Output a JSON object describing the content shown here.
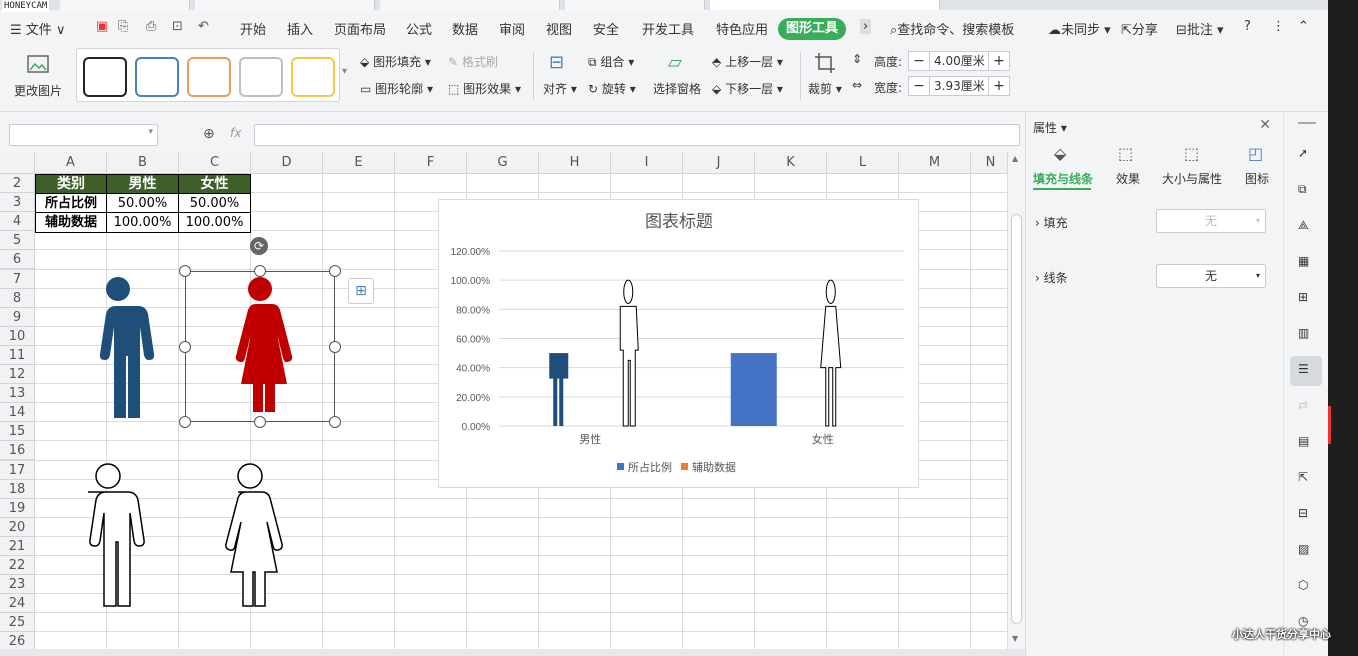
{
  "watermark_top": "HONEYCAM",
  "menu": {
    "file": "文件",
    "items": [
      "开始",
      "插入",
      "页面布局",
      "公式",
      "数据",
      "审阅",
      "视图",
      "安全",
      "开发工具",
      "特色应用"
    ],
    "active": "图形工具",
    "search": "查找命令、搜索模板",
    "sync": "未同步",
    "share": "分享",
    "annotate": "批注"
  },
  "ribbon": {
    "change_picture": "更改图片",
    "fill": "图形填充",
    "outline": "图形轮廓",
    "format_brush": "格式刷",
    "effect": "图形效果",
    "align": "对齐",
    "group": "组合",
    "rotate": "旋转",
    "selection_pane": "选择窗格",
    "bring_forward": "上移一层",
    "send_backward": "下移一层",
    "crop": "裁剪",
    "height_label": "高度:",
    "height_value": "4.00厘米",
    "width_label": "宽度:",
    "width_value": "3.93厘米",
    "swatch_colors": [
      "#222222",
      "#4a7fc1",
      "#e3a15a",
      "#bfbfbf",
      "#f2c94c"
    ]
  },
  "formula": {
    "fx": "fx"
  },
  "columns": [
    "A",
    "B",
    "C",
    "D",
    "E",
    "F",
    "G",
    "H",
    "I",
    "J",
    "K",
    "L",
    "M",
    "N"
  ],
  "rows": [
    "2",
    "3",
    "4",
    "5",
    "6",
    "7",
    "8",
    "9",
    "10",
    "11",
    "12",
    "13",
    "14",
    "15",
    "16",
    "17",
    "18",
    "19",
    "20",
    "21",
    "22",
    "23",
    "24",
    "25",
    "26"
  ],
  "table": {
    "header": [
      "类别",
      "男性",
      "女性"
    ],
    "row1": [
      "所占比例",
      "50.00%",
      "50.00%"
    ],
    "row2": [
      "辅助数据",
      "100.00%",
      "100.00%"
    ]
  },
  "colors": {
    "male": "#1f4e79",
    "female": "#c00000",
    "bar": "#4472c4",
    "series2": "#ed7d31",
    "accent": "#3aad5a"
  },
  "chart_data": {
    "type": "bar",
    "title": "图表标题",
    "categories": [
      "男性",
      "女性"
    ],
    "series": [
      {
        "name": "所占比例",
        "values": [
          50,
          50
        ]
      },
      {
        "name": "辅助数据",
        "values": [
          100,
          100
        ]
      }
    ],
    "yticks": [
      "0.00%",
      "20.00%",
      "40.00%",
      "60.00%",
      "80.00%",
      "100.00%",
      "120.00%"
    ],
    "ylim": [
      0,
      120
    ],
    "legend": "bottom",
    "grid": true
  },
  "panel": {
    "title": "属性",
    "tabs": [
      "填充与线条",
      "效果",
      "大小与属性",
      "图标"
    ],
    "fill_label": "填充",
    "fill_value": "无",
    "line_label": "线条",
    "line_value": "无"
  },
  "watermark_bottom": "小达人干货分享中心"
}
